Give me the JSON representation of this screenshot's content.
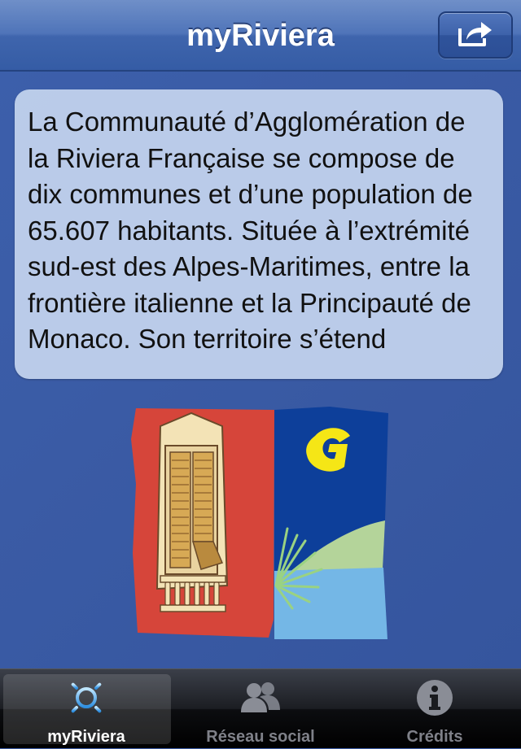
{
  "nav": {
    "title": "myRiviera",
    "share_icon": "share-icon"
  },
  "article": {
    "text": "La Communauté d’Agglomération de la Riviera Française se compose de dix communes et d’une population de 65.607 habitants. Située à l’extrémité sud-est des Alpes-Maritimes, entre la frontière italienne et la Principauté de Monaco. Son territoire s’étend"
  },
  "logo": {
    "icon": "riviera-logo",
    "colors": {
      "red": "#d6453a",
      "blue": "#0d3f9a",
      "green": "#b4d49a",
      "light_blue": "#74b7e6",
      "cream": "#f3e3b6",
      "ochre": "#d7a955",
      "yellow": "#f5e616"
    }
  },
  "tabbar": {
    "tabs": [
      {
        "label": "myRiviera",
        "icon": "sun-icon",
        "selected": true
      },
      {
        "label": "Réseau social",
        "icon": "users-icon",
        "selected": false
      },
      {
        "label": "Crédits",
        "icon": "info-icon",
        "selected": false
      }
    ]
  },
  "colors": {
    "nav_bar": "#4f74b9",
    "background": "#3a5ba5",
    "card": "#c4d4ee",
    "tab_active_text": "#ffffff",
    "tab_inactive_text": "#7f8189"
  }
}
